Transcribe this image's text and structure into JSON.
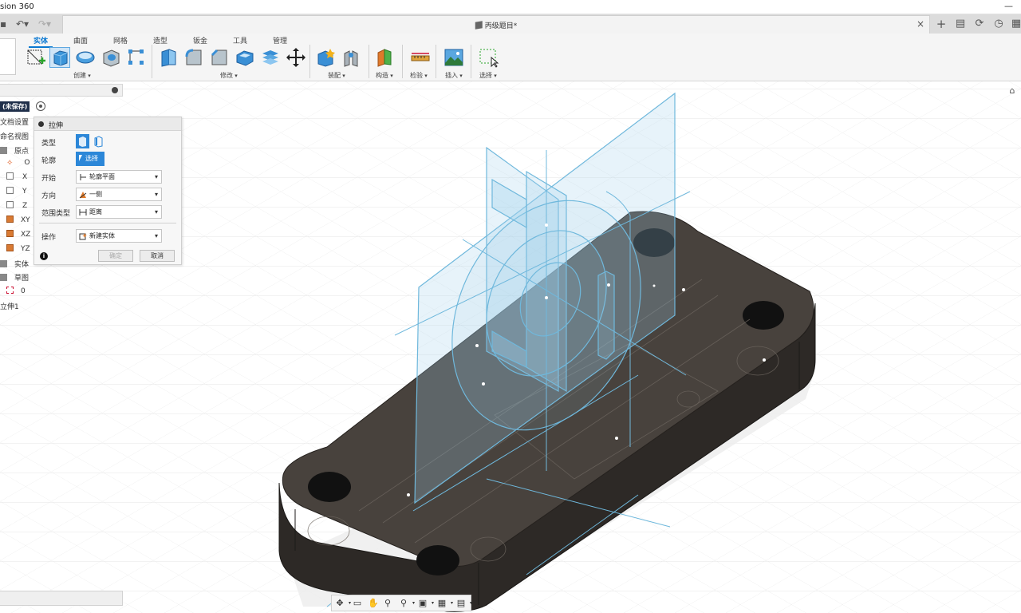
{
  "app": {
    "title": "sion 360"
  },
  "document": {
    "name": "丙级题目*"
  },
  "ribbon": {
    "tabs": [
      {
        "label": "实体",
        "active": true
      },
      {
        "label": "曲面",
        "active": false
      },
      {
        "label": "网格",
        "active": false
      },
      {
        "label": "造型",
        "active": false
      },
      {
        "label": "钣金",
        "active": false
      },
      {
        "label": "工具",
        "active": false
      },
      {
        "label": "管理",
        "active": false
      }
    ],
    "groups": [
      "创建",
      "修改",
      "装配",
      "构造",
      "检验",
      "插入",
      "选择"
    ]
  },
  "browser": {
    "root_tag": "(未保存)",
    "nodes": [
      {
        "label": "文档设置",
        "icon": "settings-icon"
      },
      {
        "label": "命名视图",
        "icon": "folder-icon"
      },
      {
        "label": "原点",
        "icon": "folder-icon"
      },
      {
        "label": "O",
        "icon": "origin-icon"
      },
      {
        "label": "X",
        "icon": "axis-icon"
      },
      {
        "label": "Y",
        "icon": "axis-icon"
      },
      {
        "label": "Z",
        "icon": "axis-icon"
      },
      {
        "label": "XY",
        "icon": "plane-icon"
      },
      {
        "label": "XZ",
        "icon": "plane-icon"
      },
      {
        "label": "YZ",
        "icon": "plane-icon"
      },
      {
        "label": "实体",
        "icon": "folder-icon"
      },
      {
        "label": "草图",
        "icon": "folder-icon"
      },
      {
        "label": "0",
        "icon": "sketch-icon"
      },
      {
        "label": "立伸1",
        "icon": ""
      }
    ]
  },
  "extrude_panel": {
    "title": "拉伸",
    "type_label": "类型",
    "profile_label": "轮廓",
    "profile_button": "选择",
    "start_label": "开始",
    "start_value": "轮廓平面",
    "direction_label": "方向",
    "direction_value": "一侧",
    "extent_label": "范围类型",
    "extent_value": "距离",
    "operation_label": "操作",
    "operation_value": "新建实体",
    "ok_label": "确定",
    "cancel_label": "取消"
  },
  "colors": {
    "accent": "#0a78d1",
    "body_top": "#48423d",
    "body_side": "#2e2a27",
    "sketch": "#6fb8dc"
  }
}
